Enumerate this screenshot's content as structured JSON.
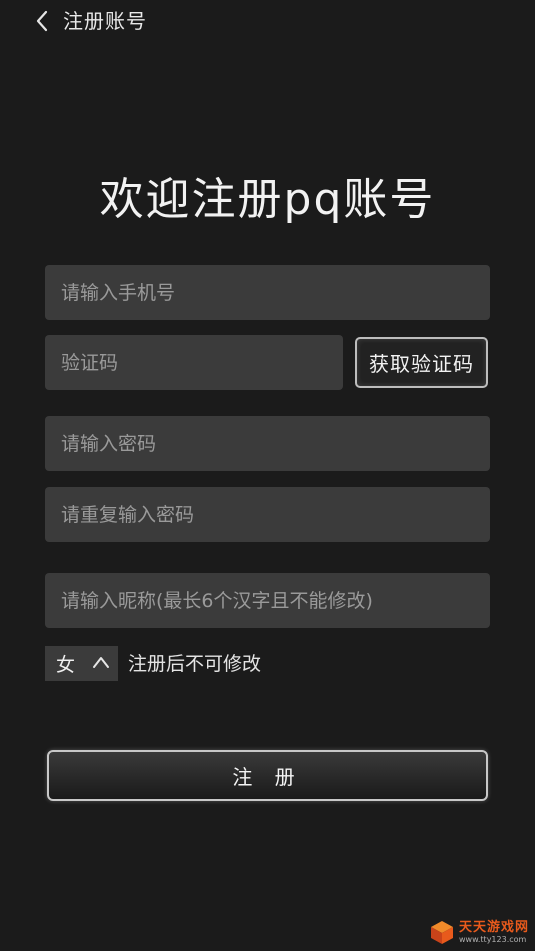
{
  "header": {
    "title": "注册账号"
  },
  "welcome": "欢迎注册pq账号",
  "form": {
    "phone_placeholder": "请输入手机号",
    "code_placeholder": "验证码",
    "get_code_label": "获取验证码",
    "password_placeholder": "请输入密码",
    "password_repeat_placeholder": "请重复输入密码",
    "nickname_placeholder": "请输入昵称(最长6个汉字且不能修改)",
    "gender_value": "女",
    "gender_hint": "注册后不可修改",
    "submit_label": "注 册"
  },
  "watermark": {
    "main": "天天游戏网",
    "sub": "www.tty123.com"
  },
  "colors": {
    "background": "#1b1b1b",
    "field": "#3b3b3b",
    "accent": "#e85a1c"
  },
  "icons": {
    "back": "chevron-left-icon",
    "gender_toggle": "chevron-up-icon",
    "watermark": "cube-logo-icon"
  }
}
